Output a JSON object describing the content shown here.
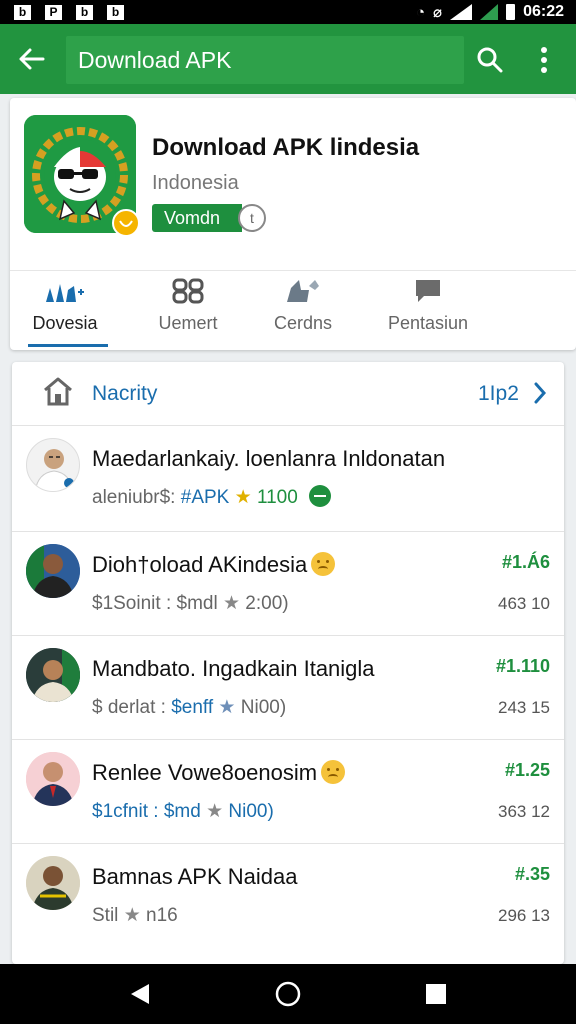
{
  "status_bar": {
    "time": "06:22",
    "notif_icons": [
      "b",
      "P",
      "b",
      "b"
    ]
  },
  "app_bar": {
    "search_text": "Download APK",
    "back_icon": "arrow-left-icon",
    "search_icon": "search-icon",
    "more_icon": "more-vert-icon"
  },
  "app": {
    "title": "Download APK lindesia",
    "subtitle": "Indonesia",
    "install_label": "Vomdn",
    "ring_glyph": "t"
  },
  "tabs": [
    {
      "label": "Dovesia",
      "icon": "hands-icon",
      "active": true
    },
    {
      "label": "Uemert",
      "icon": "grid-icon",
      "active": false
    },
    {
      "label": "Cerdns",
      "icon": "thumbs-icon",
      "active": false
    },
    {
      "label": "Pentasiun",
      "icon": "message-icon",
      "active": false
    }
  ],
  "list": {
    "title": "Nacrity",
    "count": "1Ip2",
    "rows": [
      {
        "name": "Maedarlankaiy. loenlanra Inldonatan",
        "meta_a": "aleniubr$:",
        "meta_b": "APK",
        "meta_c": "1100",
        "price": "",
        "stat": ""
      },
      {
        "name": "Dioh†oload AKindesia",
        "meta_a": "$1Soinit : $mdl",
        "meta_b": "2:00)",
        "price": "#1.Á6",
        "stat": "463 10"
      },
      {
        "name": "Mandbato. Ingadkain Itanigla",
        "meta_a": "$ derlat : ",
        "meta_blue": "$enff",
        "meta_b": "Ni00)",
        "price": "#1.110",
        "stat": "243 15"
      },
      {
        "name": "Renlee Vowe8oenosim",
        "meta_a": "$1cfnit : $md",
        "meta_b": "Ni00)",
        "price": "#1.25",
        "stat": "363 12"
      },
      {
        "name": "Bamnas APK Naidaa",
        "meta_a": "Stil",
        "meta_b": "n16",
        "price": "#.35",
        "stat": "296 13"
      }
    ]
  },
  "colors": {
    "app_bar": "#22943f",
    "accent_blue": "#1a6dad",
    "price_green": "#1e8f3e"
  }
}
